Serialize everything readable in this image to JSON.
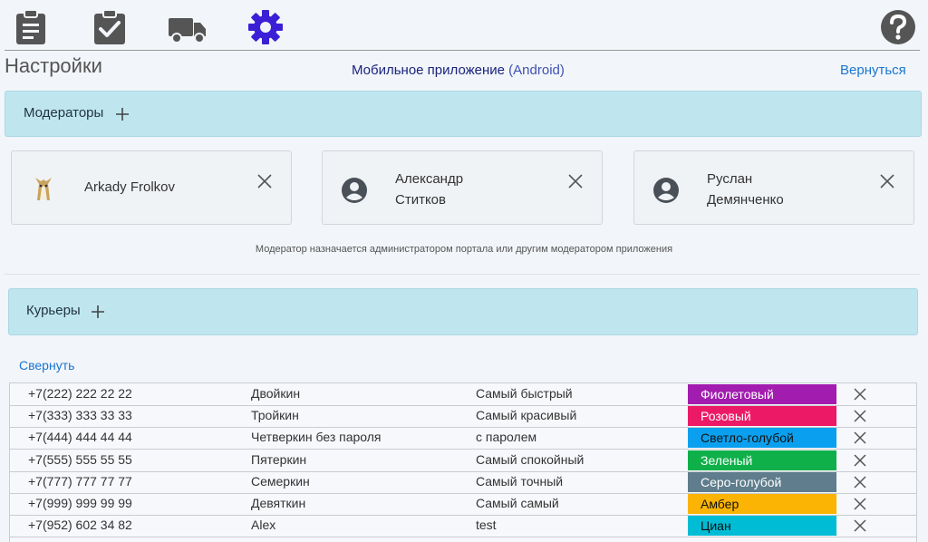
{
  "toolbar": {
    "icons": [
      "clipboard-icon",
      "clipboard-check-icon",
      "truck-icon",
      "gear-icon",
      "help-icon"
    ],
    "active_color": "#3b1fd6",
    "inactive_color": "#555555"
  },
  "header": {
    "title": "Настройки",
    "app_name": "Мобильное приложение",
    "platform": "(Android)",
    "back_label": "Вернуться"
  },
  "moderators": {
    "label": "Модераторы",
    "cards": [
      {
        "line1": "Arkady Frolkov",
        "line2": ""
      },
      {
        "line1": "Александр",
        "line2": "Ститков"
      },
      {
        "line1": "Руслан",
        "line2": "Демянченко"
      }
    ],
    "hint": "Модератор назначается администратором портала или другим модератором приложения"
  },
  "couriers": {
    "label": "Курьеры",
    "collapse_label": "Свернуть",
    "rows": [
      {
        "phone": "+7(222) 222 22 22",
        "name": "Двойкин",
        "desc": "Самый быстрый",
        "color_name": "Фиолетовый",
        "color": "#a21caf",
        "text_color": "#ffffff"
      },
      {
        "phone": "+7(333) 333 33 33",
        "name": "Тройкин",
        "desc": "Самый красивый",
        "color_name": "Розовый",
        "color": "#ec1a66",
        "text_color": "#ffffff"
      },
      {
        "phone": "+7(444) 444 44 44",
        "name": "Четверкин без пароля",
        "desc": "с паролем",
        "color_name": "Светло-голубой",
        "color": "#0aa0ef",
        "text_color": "#111111"
      },
      {
        "phone": "+7(555) 555 55 55",
        "name": "Пятеркин",
        "desc": "Самый спокойный",
        "color_name": "Зеленый",
        "color": "#0fb04a",
        "text_color": "#ffffff"
      },
      {
        "phone": "+7(777) 777 77 77",
        "name": "Семеркин",
        "desc": "Самый точный",
        "color_name": "Серо-голубой",
        "color": "#5f7d8c",
        "text_color": "#ffffff"
      },
      {
        "phone": "+7(999) 999 99 99",
        "name": "Девяткин",
        "desc": "Самый самый",
        "color_name": "Амбер",
        "color": "#fbb404",
        "text_color": "#111111"
      },
      {
        "phone": "+7(952) 602 34 82",
        "name": "Alex",
        "desc": "test",
        "color_name": "Циан",
        "color": "#00bcd4",
        "text_color": "#111111"
      }
    ]
  }
}
